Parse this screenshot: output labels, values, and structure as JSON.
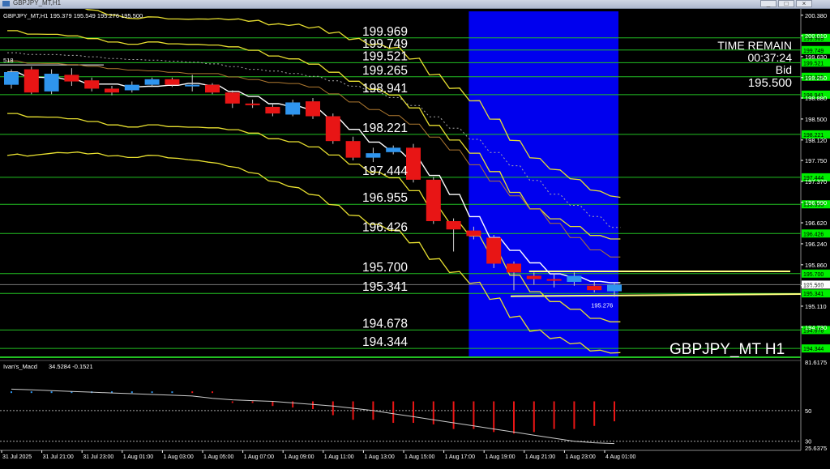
{
  "window": {
    "title": "GBPJPY_MT,H1",
    "controls": [
      "_",
      "□",
      "×"
    ]
  },
  "chart_data": [
    {
      "type": "candlestick",
      "info_line": "GBPJPY_MT,H1  195.379 195.549 195.276 195.500",
      "symbol_label": "GBPJPY_MT H1",
      "panel_label": {
        "time_remain_label": "TIME REMAIN",
        "time_remain_value": "00:37:24",
        "bid_label": "Bid",
        "bid_value": "195.500"
      },
      "corner_label": "518",
      "low_marker": "195.276",
      "ylim": [
        194.2,
        200.45
      ],
      "price_ticks": [
        200.38,
        200.01,
        199.63,
        199.25,
        198.88,
        198.5,
        198.12,
        197.75,
        197.37,
        196.99,
        196.62,
        196.24,
        195.86,
        195.48,
        195.11,
        194.73
      ],
      "price_tick_labels": [
        "200.380",
        "200.010",
        "199.630",
        "199.250",
        "198.880",
        "198.500",
        "198.120",
        "197.750",
        "197.370",
        "196.990",
        "196.620",
        "196.240",
        "195.860",
        "195.480",
        "195.110",
        "194.730"
      ],
      "levels": [
        199.969,
        199.749,
        199.521,
        199.265,
        198.941,
        198.221,
        197.444,
        196.955,
        196.426,
        195.7,
        195.341,
        194.678,
        194.344
      ],
      "level_labels": [
        "199.969",
        "199.749",
        "199.521",
        "199.265",
        "198.941",
        "198.221",
        "197.444",
        "196.955",
        "196.426",
        "195.700",
        "195.341",
        "194.678",
        "194.344"
      ],
      "current_price": 195.5,
      "current_price_label": "195.500",
      "candles": [
        {
          "o": 199.12,
          "c": 199.35,
          "h": 199.4,
          "l": 199.05
        },
        {
          "o": 199.4,
          "c": 198.98,
          "h": 199.45,
          "l": 198.95
        },
        {
          "o": 199.0,
          "c": 199.32,
          "h": 199.4,
          "l": 198.95
        },
        {
          "o": 199.3,
          "c": 199.18,
          "h": 199.42,
          "l": 199.1
        },
        {
          "o": 199.2,
          "c": 199.05,
          "h": 199.25,
          "l": 199.0
        },
        {
          "o": 199.05,
          "c": 198.98,
          "h": 199.1,
          "l": 198.93
        },
        {
          "o": 199.02,
          "c": 199.12,
          "h": 199.18,
          "l": 198.98
        },
        {
          "o": 199.12,
          "c": 199.22,
          "h": 199.25,
          "l": 199.08
        },
        {
          "o": 199.22,
          "c": 199.12,
          "h": 199.25,
          "l": 199.08
        },
        {
          "o": 199.1,
          "c": 199.12,
          "h": 199.3,
          "l": 199.0
        },
        {
          "o": 199.12,
          "c": 198.98,
          "h": 199.15,
          "l": 198.95
        },
        {
          "o": 198.98,
          "c": 198.78,
          "h": 199.02,
          "l": 198.7
        },
        {
          "o": 198.78,
          "c": 198.75,
          "h": 198.85,
          "l": 198.7
        },
        {
          "o": 198.72,
          "c": 198.6,
          "h": 198.78,
          "l": 198.55
        },
        {
          "o": 198.58,
          "c": 198.8,
          "h": 198.85,
          "l": 198.55
        },
        {
          "o": 198.82,
          "c": 198.55,
          "h": 198.88,
          "l": 198.5
        },
        {
          "o": 198.55,
          "c": 198.1,
          "h": 198.6,
          "l": 198.05
        },
        {
          "o": 198.1,
          "c": 197.8,
          "h": 198.18,
          "l": 197.75
        },
        {
          "o": 197.8,
          "c": 197.88,
          "h": 197.98,
          "l": 197.72
        },
        {
          "o": 197.9,
          "c": 197.98,
          "h": 198.02,
          "l": 197.86
        },
        {
          "o": 197.98,
          "c": 197.4,
          "h": 198.05,
          "l": 197.35
        },
        {
          "o": 197.4,
          "c": 196.65,
          "h": 197.45,
          "l": 196.6
        },
        {
          "o": 196.65,
          "c": 196.5,
          "h": 196.7,
          "l": 196.1
        },
        {
          "o": 196.48,
          "c": 196.38,
          "h": 196.55,
          "l": 196.32
        },
        {
          "o": 196.35,
          "c": 195.88,
          "h": 196.4,
          "l": 195.8
        },
        {
          "o": 195.88,
          "c": 195.72,
          "h": 195.92,
          "l": 195.4
        },
        {
          "o": 195.66,
          "c": 195.6,
          "h": 195.72,
          "l": 195.5
        },
        {
          "o": 195.6,
          "c": 195.58,
          "h": 195.7,
          "l": 195.45
        },
        {
          "o": 195.55,
          "c": 195.66,
          "h": 195.72,
          "l": 195.48
        },
        {
          "o": 195.48,
          "c": 195.4,
          "h": 195.56,
          "l": 195.36
        },
        {
          "o": 195.38,
          "c": 195.5,
          "h": 195.55,
          "l": 195.28
        }
      ],
      "highlight_zone": {
        "from_candle": 23,
        "to_candle": 30,
        "color": "#0000ee"
      }
    },
    {
      "type": "line",
      "label": "Ivan's_Macd",
      "values_label": "34.5284 -0.1521",
      "ylim": [
        25.6375,
        81.6175
      ],
      "ticks": [
        81.6175,
        50,
        30,
        25.6375
      ],
      "tick_labels": [
        "81.6175",
        "50",
        "30",
        "25.6375"
      ],
      "histogram": [
        {
          "v": 62,
          "c": "blue"
        },
        {
          "v": 62,
          "c": "blue"
        },
        {
          "v": 62,
          "c": "blue"
        },
        {
          "v": 62,
          "c": "blue"
        },
        {
          "v": 62,
          "c": "blue"
        },
        {
          "v": 62,
          "c": "blue"
        },
        {
          "v": 62,
          "c": "blue"
        },
        {
          "v": 62,
          "c": "blue"
        },
        {
          "v": 62,
          "c": "blue"
        },
        {
          "v": 62,
          "c": "red"
        },
        {
          "v": 62,
          "c": "red"
        },
        {
          "v": 55,
          "c": "red"
        },
        {
          "v": 55,
          "c": "red"
        },
        {
          "v": 53,
          "c": "red"
        },
        {
          "v": 52,
          "c": "red"
        },
        {
          "v": 51,
          "c": "red"
        },
        {
          "v": 47,
          "c": "red"
        },
        {
          "v": 44,
          "c": "red"
        },
        {
          "v": 44,
          "c": "red"
        },
        {
          "v": 42,
          "c": "red"
        },
        {
          "v": 42,
          "c": "red"
        },
        {
          "v": 41,
          "c": "red"
        },
        {
          "v": 38,
          "c": "red"
        },
        {
          "v": 38,
          "c": "red"
        },
        {
          "v": 36,
          "c": "red"
        },
        {
          "v": 35,
          "c": "red"
        },
        {
          "v": 36,
          "c": "red"
        },
        {
          "v": 38,
          "c": "red"
        },
        {
          "v": 38,
          "c": "red"
        },
        {
          "v": 40,
          "c": "red"
        },
        {
          "v": 43,
          "c": "red"
        }
      ],
      "signal": [
        64,
        63.5,
        63,
        62.5,
        62,
        61.5,
        61,
        60.5,
        60,
        59.5,
        58,
        57,
        56.5,
        56,
        55,
        54,
        53,
        51.5,
        50,
        48,
        46,
        44,
        42,
        40,
        38,
        36,
        34,
        32,
        30,
        29,
        28.5
      ]
    }
  ],
  "time_axis": {
    "labels": [
      "31 Jul 2025",
      "31 Jul 21:00",
      "31 Jul 23:00",
      "1 Aug 01:00",
      "1 Aug 03:00",
      "1 Aug 05:00",
      "1 Aug 07:00",
      "1 Aug 09:00",
      "1 Aug 11:00",
      "1 Aug 13:00",
      "1 Aug 15:00",
      "1 Aug 17:00",
      "1 Aug 19:00",
      "1 Aug 21:00",
      "1 Aug 23:00",
      "4 Aug 01:00"
    ]
  },
  "colors": {
    "background": "#000000",
    "bull_candle": "#2f95ee",
    "bear_candle": "#e81515",
    "level_line": "#22c022",
    "band_line": "#e8e030",
    "ma_line": "#ffffff",
    "badge_fill": "#00ee00"
  }
}
